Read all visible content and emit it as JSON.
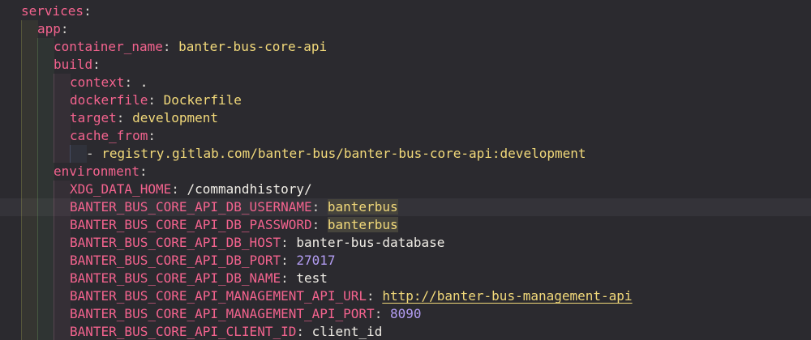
{
  "editor": {
    "lines": [
      {
        "key": "services",
        "colon": ":"
      },
      {
        "key": "app",
        "colon": ":"
      },
      {
        "key": "container_name",
        "colon": ": ",
        "value": "banter-bus-core-api"
      },
      {
        "key": "build",
        "colon": ":"
      },
      {
        "key": "context",
        "colon": ": ",
        "value": "."
      },
      {
        "key": "dockerfile",
        "colon": ": ",
        "value": "Dockerfile"
      },
      {
        "key": "target",
        "colon": ": ",
        "value": "development"
      },
      {
        "key": "cache_from",
        "colon": ":"
      },
      {
        "dash": "- ",
        "value": "registry.gitlab.com/banter-bus/banter-bus-core-api:development"
      },
      {
        "key": "environment",
        "colon": ":"
      },
      {
        "key": "XDG_DATA_HOME",
        "colon": ": ",
        "value": "/commandhistory/"
      },
      {
        "key": "BANTER_BUS_CORE_API_DB_USERNAME",
        "colon": ": ",
        "value": "banterbus"
      },
      {
        "key": "BANTER_BUS_CORE_API_DB_PASSWORD",
        "colon": ": ",
        "value": "banterbus"
      },
      {
        "key": "BANTER_BUS_CORE_API_DB_HOST",
        "colon": ": ",
        "value": "banter-bus-database"
      },
      {
        "key": "BANTER_BUS_CORE_API_DB_PORT",
        "colon": ": ",
        "value": "27017"
      },
      {
        "key": "BANTER_BUS_CORE_API_DB_NAME",
        "colon": ": ",
        "value": "test"
      },
      {
        "key": "BANTER_BUS_CORE_API_MANAGEMENT_API_URL",
        "colon": ": ",
        "value": "http://banter-bus-management-api"
      },
      {
        "key": "BANTER_BUS_CORE_API_MANAGEMENT_API_PORT",
        "colon": ": ",
        "value": "8090"
      },
      {
        "key": "BANTER_BUS_CORE_API_CLIENT_ID",
        "colon": ": ",
        "value": "client_id"
      }
    ]
  },
  "colors": {
    "background": "#2b2a2f",
    "key": "#f3638e",
    "string": "#f2d97a",
    "number": "#b39df3",
    "plain": "#f0ede6"
  }
}
